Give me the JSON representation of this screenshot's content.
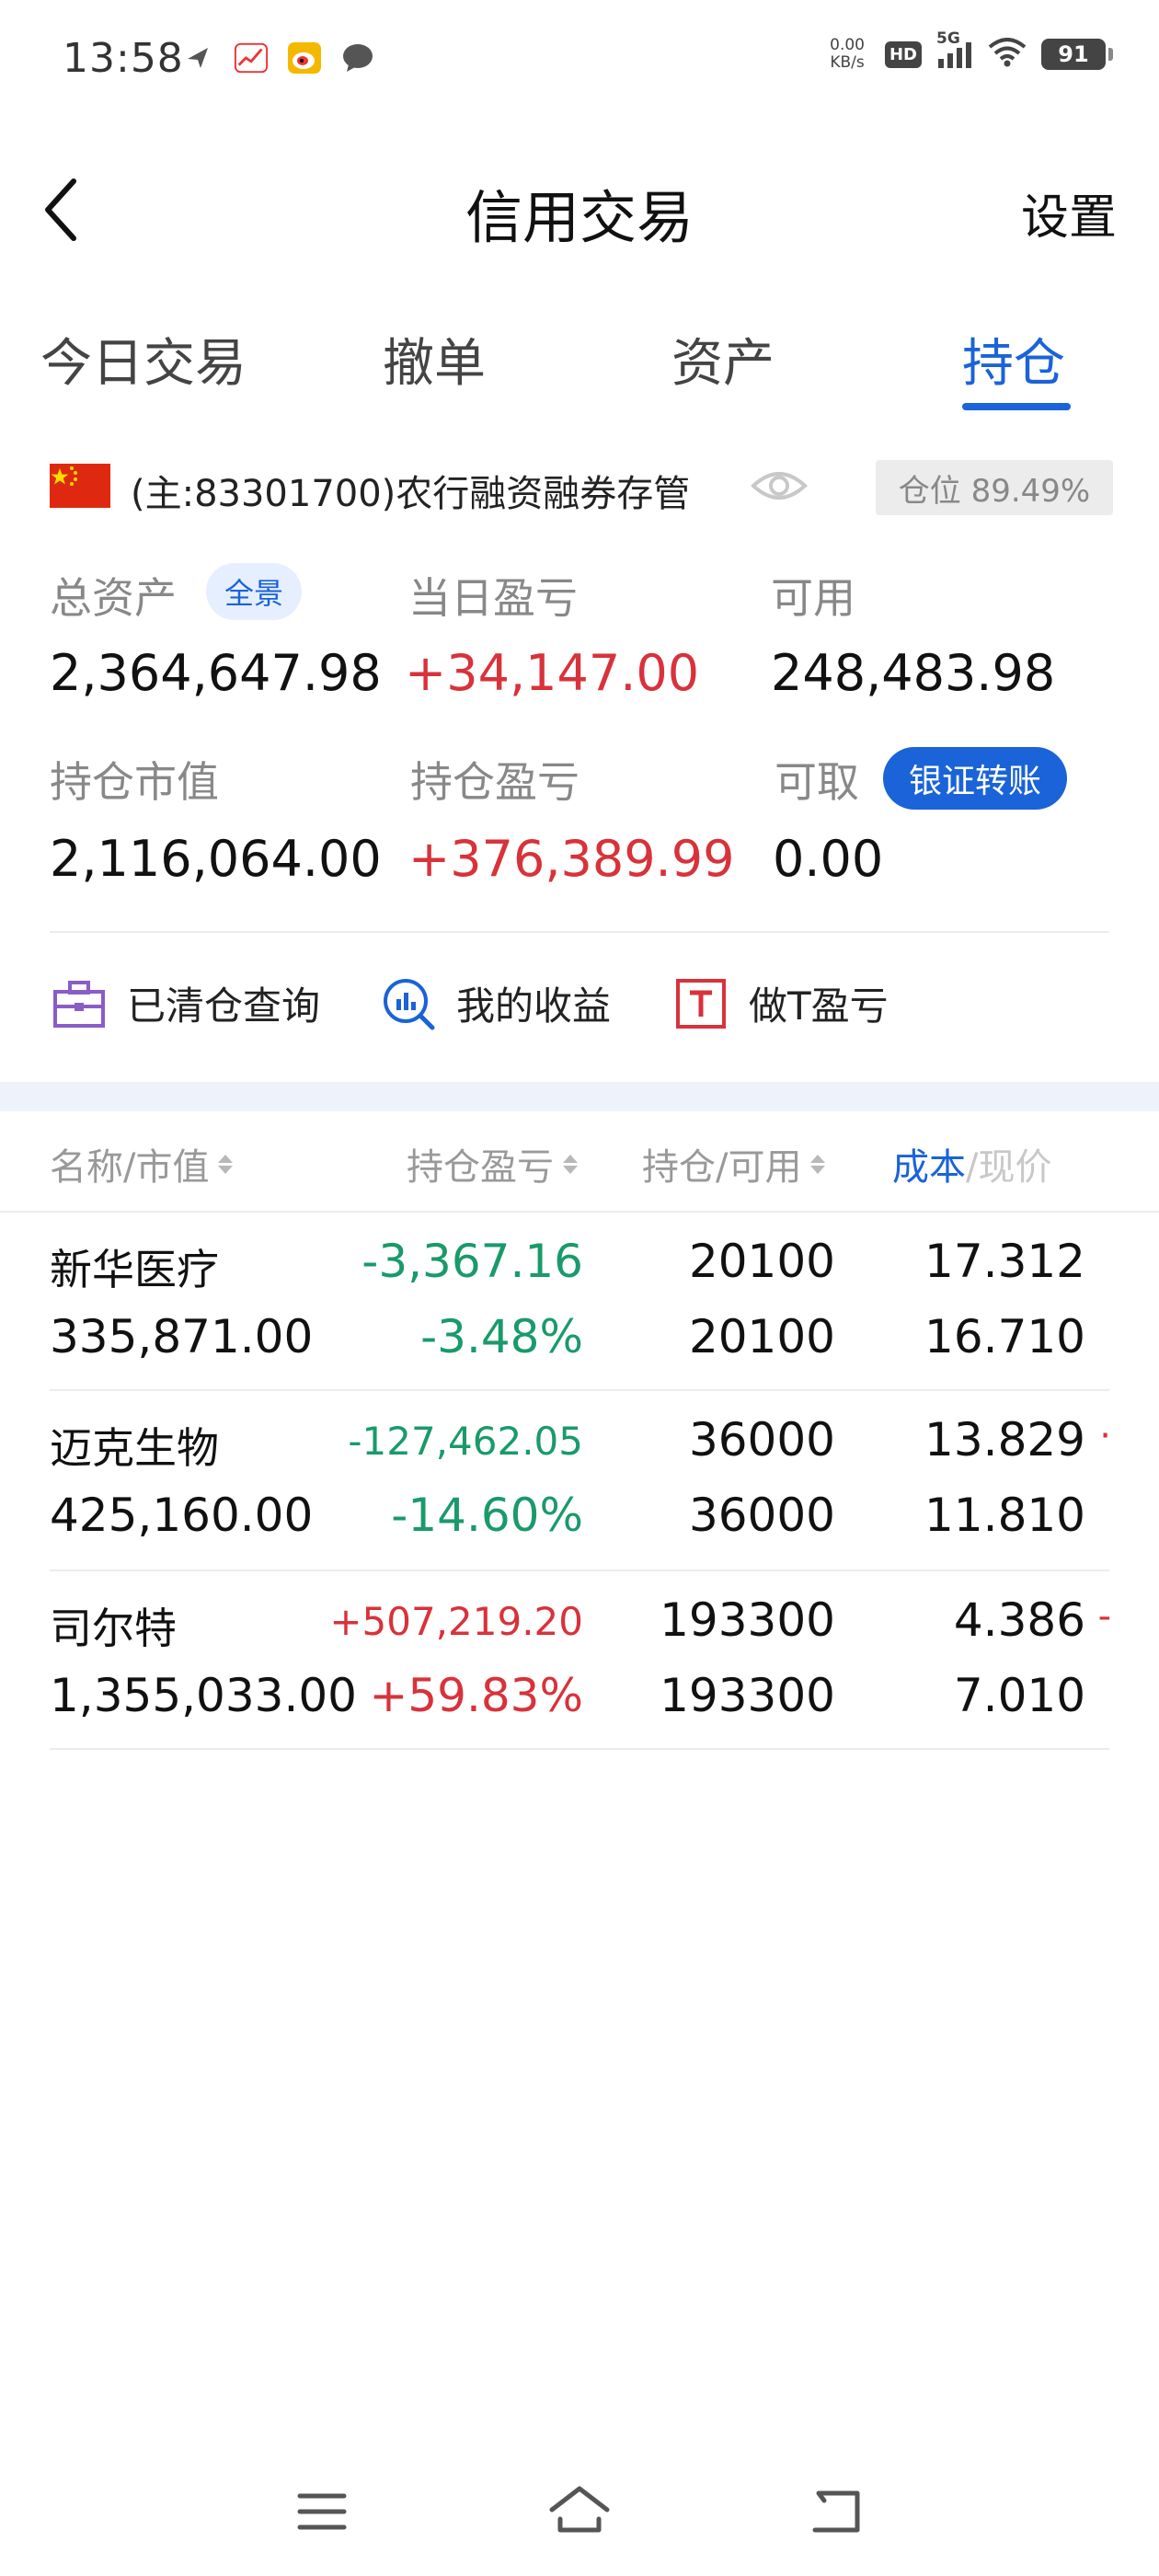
{
  "status_bar": {
    "time": "13:58",
    "net_speed_value": "0.00",
    "net_speed_unit": "KB/s",
    "hd": "HD",
    "network": "5G",
    "battery": "91",
    "icons": [
      "send-icon",
      "stock-app-icon",
      "weibo-icon",
      "message-icon",
      "signal-icon",
      "wifi-icon",
      "battery-icon"
    ]
  },
  "header": {
    "title": "信用交易",
    "settings_label": "设置"
  },
  "tabs": [
    {
      "label": "今日交易"
    },
    {
      "label": "撤单"
    },
    {
      "label": "资产"
    },
    {
      "label": "持仓",
      "active": true
    }
  ],
  "account": {
    "name": "(主:83301700)农行融资融券存管",
    "position_ratio": "仓位 89.49%"
  },
  "assets": {
    "total_label": "总资产",
    "total_tag": "全景",
    "total_value": "2,364,647.98",
    "daily_pl_label": "当日盈亏",
    "daily_pl_value": "+34,147.00",
    "available_label": "可用",
    "available_value": "248,483.98",
    "market_value_label": "持仓市值",
    "market_value": "2,116,064.00",
    "position_pl_label": "持仓盈亏",
    "position_pl_value": "+376,389.99",
    "withdrawable_label": "可取",
    "transfer_label": "银证转账",
    "withdrawable_value": "0.00"
  },
  "quick_actions": [
    {
      "label": "已清仓查询",
      "icon": "briefcase-icon"
    },
    {
      "label": "我的收益",
      "icon": "chart-search-icon"
    },
    {
      "label": "做T盈亏",
      "icon": "t-box-icon"
    }
  ],
  "table": {
    "headers": {
      "name": "名称/市值",
      "pl": "持仓盈亏",
      "qty": "持仓/可用",
      "cost_a": "成本",
      "cost_b": "/现价"
    },
    "rows": [
      {
        "name": "新华医疗",
        "market_value": "335,871.00",
        "pl": "-3,367.16",
        "pl_pct": "-3.48%",
        "qty": "20100",
        "available": "20100",
        "cost": "17.312",
        "price": "16.710",
        "direction": "down"
      },
      {
        "name": "迈克生物",
        "market_value": "425,160.00",
        "pl": "-127,462.05",
        "pl_pct": "-14.60%",
        "qty": "36000",
        "available": "36000",
        "cost": "13.829",
        "price": "11.810",
        "direction": "down"
      },
      {
        "name": "司尔特",
        "market_value": "1,355,033.00",
        "pl": "+507,219.20",
        "pl_pct": "+59.83%",
        "qty": "193300",
        "available": "193300",
        "cost": "4.386",
        "price": "7.010",
        "direction": "up"
      }
    ]
  },
  "colors": {
    "accent": "#1a63d8",
    "up": "#d8323b",
    "down": "#1a9a6b"
  }
}
